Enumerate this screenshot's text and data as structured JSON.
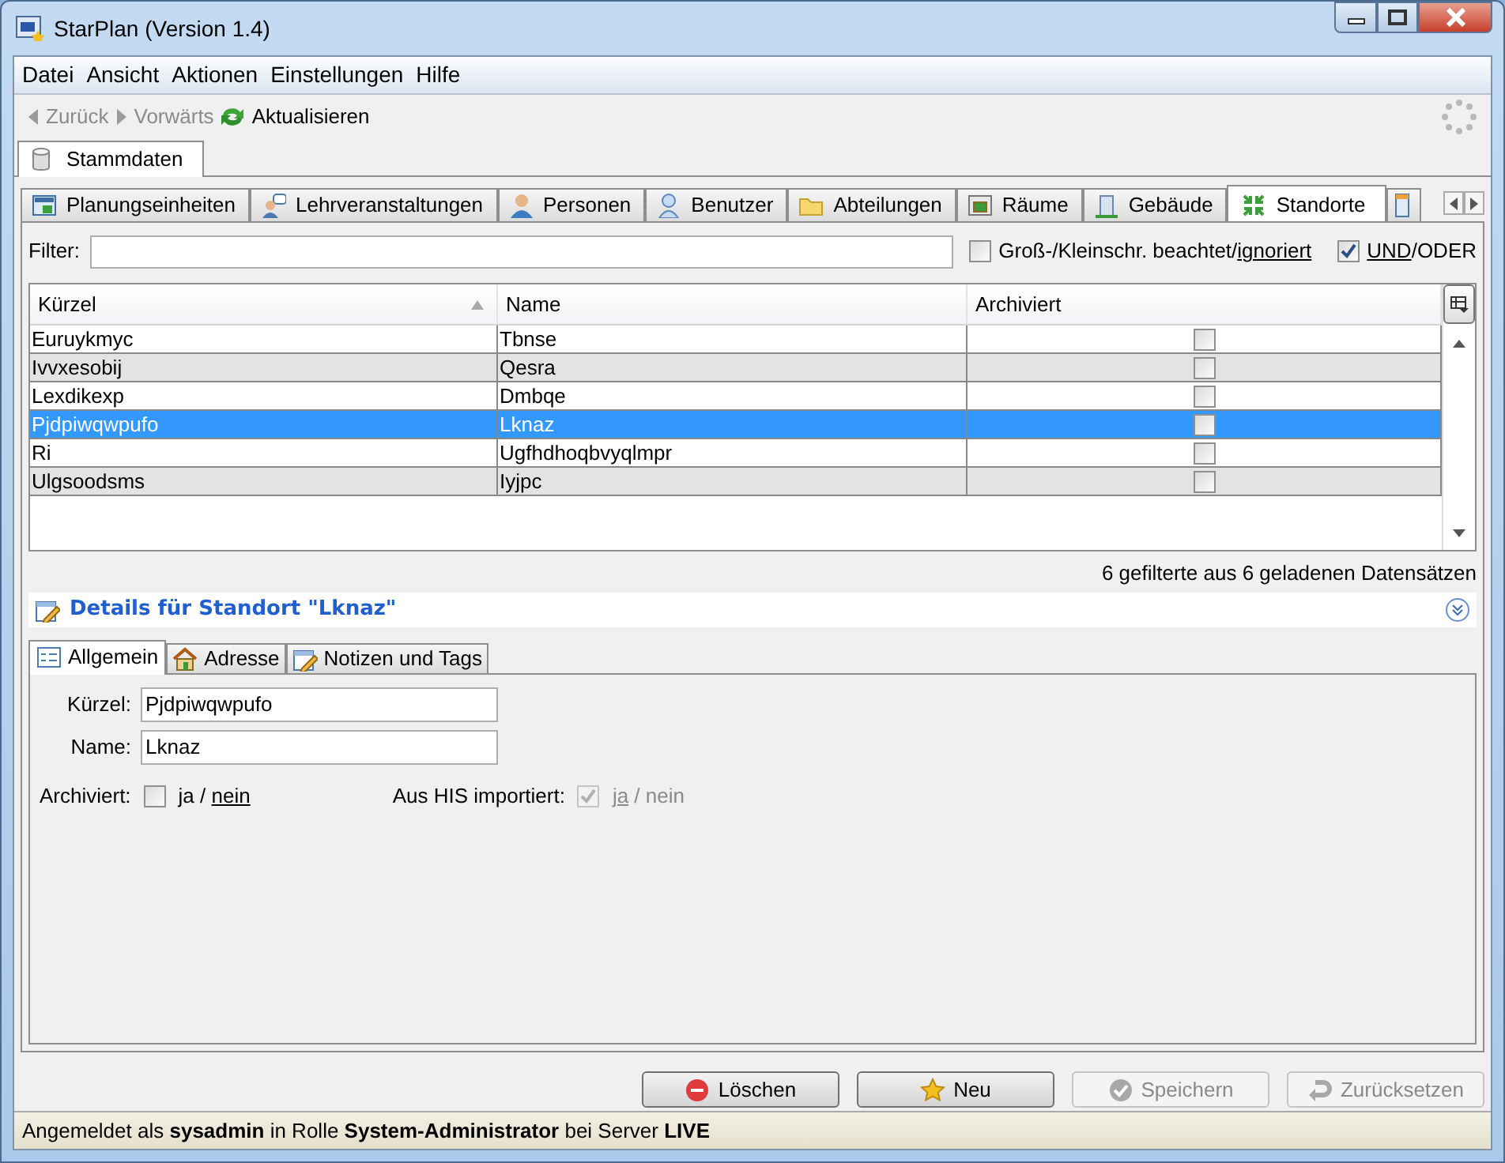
{
  "window": {
    "title": "StarPlan (Version 1.4)"
  },
  "menu": [
    {
      "label": "Datei"
    },
    {
      "label": "Ansicht"
    },
    {
      "label": "Aktionen"
    },
    {
      "label": "Einstellungen"
    },
    {
      "label": "Hilfe"
    }
  ],
  "toolbar": [
    {
      "label": "Zurück",
      "kind": "back",
      "disabled": true
    },
    {
      "label": "Vorwärts",
      "kind": "forward",
      "disabled": true
    },
    {
      "label": "Aktualisieren",
      "kind": "refresh",
      "disabled": false
    }
  ],
  "main_tabs": [
    {
      "label": "Stammdaten",
      "selected": true
    }
  ],
  "entity_tabs": [
    {
      "label": "Planungseinheiten",
      "kind": "grid",
      "selected": false
    },
    {
      "label": "Lehrveranstaltungen",
      "kind": "lecture",
      "selected": false
    },
    {
      "label": "Personen",
      "kind": "person",
      "selected": false
    },
    {
      "label": "Benutzer",
      "kind": "user",
      "selected": false
    },
    {
      "label": "Abteilungen",
      "kind": "folder",
      "selected": false
    },
    {
      "label": "Räume",
      "kind": "room",
      "selected": false
    },
    {
      "label": "Gebäude",
      "kind": "building",
      "selected": false
    },
    {
      "label": "Standorte",
      "kind": "location",
      "selected": true
    },
    {
      "kind": "column",
      "selected": false
    }
  ],
  "filter": {
    "label": "Filter:"
  },
  "case_option": {
    "checked": false,
    "separator": "/",
    "options": [
      {
        "label": "Groß-/Kleinschr. beachtet",
        "selected": false
      },
      {
        "label": "ignoriert",
        "selected": true
      }
    ]
  },
  "logic_option": {
    "checked": true,
    "separator": "/",
    "options": [
      {
        "label": "UND",
        "selected": true
      },
      {
        "label": "ODER",
        "selected": false
      }
    ]
  },
  "table": {
    "columns": [
      {
        "label": "Kürzel",
        "sorted": true
      },
      {
        "label": "Name",
        "sorted": false
      },
      {
        "label": "Archiviert",
        "sorted": false
      }
    ],
    "rows": [
      {
        "cells": [
          "Euruykmyc",
          "Tbnse"
        ],
        "archived": false,
        "selected": false
      },
      {
        "cells": [
          "Ivvxesobij",
          "Qesra"
        ],
        "archived": false,
        "selected": false
      },
      {
        "cells": [
          "Lexdikexp",
          "Dmbqe"
        ],
        "archived": false,
        "selected": false
      },
      {
        "cells": [
          "Pjdpiwqwpufo",
          "Lknaz"
        ],
        "archived": false,
        "selected": true
      },
      {
        "cells": [
          "Ri",
          "Ugfhdhoqbvyqlmpr"
        ],
        "archived": false,
        "selected": false
      },
      {
        "cells": [
          "Ulgsoodsms",
          "Iyjpc"
        ],
        "archived": false,
        "selected": false
      }
    ]
  },
  "record_count": "6 gefilterte aus 6 geladenen Datensätzen",
  "details": {
    "title": "Details für Standort \"Lknaz\"",
    "tabs": [
      {
        "label": "Allgemein",
        "kind": "form",
        "selected": true
      },
      {
        "label": "Adresse",
        "kind": "house",
        "selected": false
      },
      {
        "label": "Notizen und Tags",
        "kind": "note",
        "selected": false
      }
    ],
    "fields": [
      {
        "label": "Kürzel:",
        "value": "Pjdpiwqwpufo"
      },
      {
        "label": "Name:",
        "value": "Lknaz"
      }
    ],
    "options": [
      {
        "label": "Archiviert:",
        "checked": false,
        "disabled": false,
        "separator": " / ",
        "options": [
          {
            "label": "ja",
            "selected": false
          },
          {
            "label": "nein",
            "selected": true
          }
        ]
      },
      {
        "label": "Aus HIS importiert:",
        "checked": true,
        "disabled": true,
        "separator": " / ",
        "options": [
          {
            "label": "ja",
            "selected": true
          },
          {
            "label": "nein",
            "selected": false
          }
        ]
      }
    ]
  },
  "buttons": [
    {
      "label": "Löschen",
      "kind": "delete",
      "disabled": false
    },
    {
      "label": "Neu",
      "kind": "new",
      "disabled": false
    },
    {
      "label": "Speichern",
      "kind": "save",
      "disabled": true
    },
    {
      "label": "Zurücksetzen",
      "kind": "reset",
      "disabled": true
    }
  ],
  "status_bar": {
    "text": "Angemeldet als **sysadmin** in Rolle **System-Administrator** bei Server **LIVE**"
  }
}
